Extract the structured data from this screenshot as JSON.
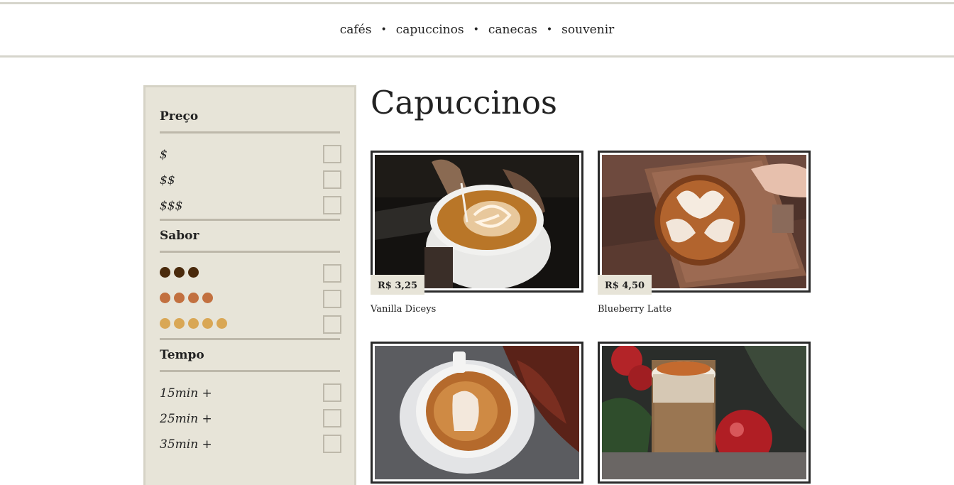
{
  "nav": {
    "items": [
      "cafés",
      "capuccinos",
      "canecas",
      "souvenir"
    ],
    "separator": "•"
  },
  "sidebar": {
    "sections": [
      {
        "title": "Preço",
        "options": [
          "$",
          "$$",
          "$$$"
        ]
      },
      {
        "title": "Sabor",
        "options": [
          {
            "dots": 3,
            "color": "#4a2a0c"
          },
          {
            "dots": 4,
            "color": "#c2703f"
          },
          {
            "dots": 5,
            "color": "#d9a755"
          }
        ]
      },
      {
        "title": "Tempo",
        "options": [
          "15min +",
          "25min +",
          "35min +"
        ]
      }
    ]
  },
  "page": {
    "title": "Capuccinos"
  },
  "products": [
    {
      "name": "Vanilla Diceys",
      "price": "R$ 3,25"
    },
    {
      "name": "Blueberry Latte",
      "price": "R$ 4,50"
    },
    {
      "name": "",
      "price": ""
    },
    {
      "name": "",
      "price": ""
    }
  ]
}
